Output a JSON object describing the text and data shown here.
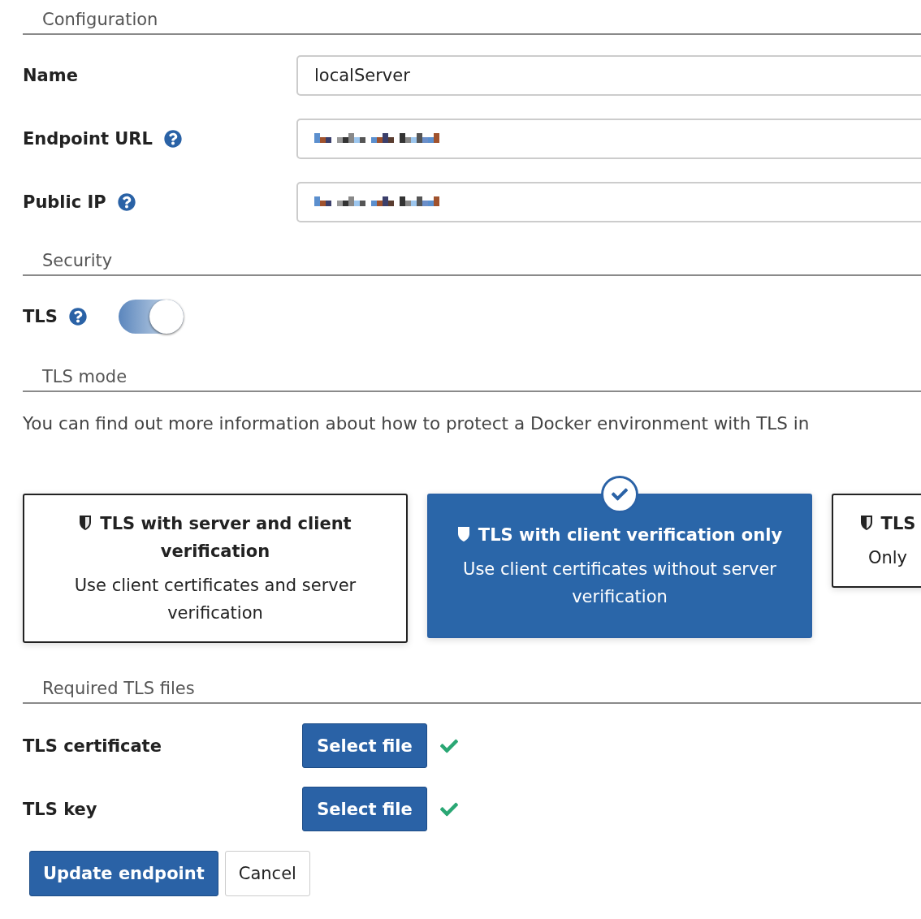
{
  "configuration": {
    "heading": "Configuration",
    "fields": [
      {
        "label": "Name",
        "help": false,
        "value": "localServer",
        "value_hidden": false
      },
      {
        "label": "Endpoint URL",
        "help": true,
        "value_hidden": true
      },
      {
        "label": "Public IP",
        "help": true,
        "value_hidden": true
      }
    ]
  },
  "security": {
    "heading": "Security",
    "tls": {
      "label": "TLS",
      "help": true,
      "on": true
    }
  },
  "tls_mode": {
    "heading": "TLS mode",
    "info": "You can find out more information about how to protect a Docker environment with TLS in",
    "options": [
      {
        "title": "TLS with server and client verification",
        "description": "Use client certificates and server verification",
        "selected": false
      },
      {
        "title": "TLS with client verification only",
        "description": "Use client certificates without server verification",
        "selected": true
      },
      {
        "title": "TLS",
        "description": "Only",
        "selected": false
      }
    ]
  },
  "files": {
    "heading": "Required TLS files",
    "items": [
      {
        "label": "TLS certificate",
        "button": "Select file",
        "uploaded": true
      },
      {
        "label": "TLS key",
        "button": "Select file",
        "uploaded": true
      }
    ]
  },
  "actions": [
    {
      "label": "Update endpoint",
      "kind": "primary"
    },
    {
      "label": "Cancel",
      "kind": "default"
    }
  ]
}
